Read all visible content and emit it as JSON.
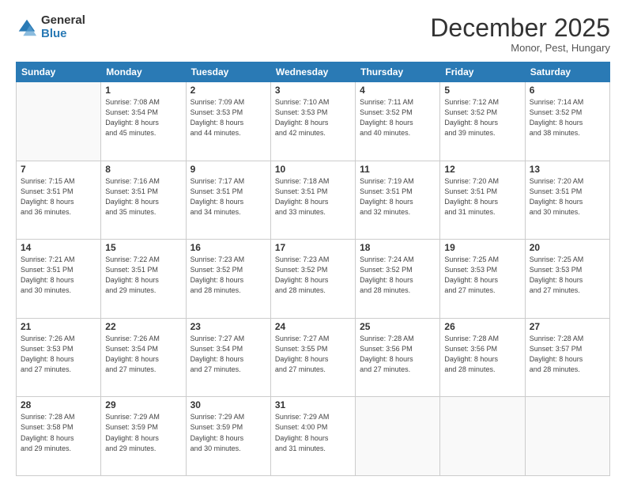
{
  "logo": {
    "general": "General",
    "blue": "Blue"
  },
  "header": {
    "month": "December 2025",
    "location": "Monor, Pest, Hungary"
  },
  "weekdays": [
    "Sunday",
    "Monday",
    "Tuesday",
    "Wednesday",
    "Thursday",
    "Friday",
    "Saturday"
  ],
  "weeks": [
    [
      {
        "day": "",
        "info": ""
      },
      {
        "day": "1",
        "info": "Sunrise: 7:08 AM\nSunset: 3:54 PM\nDaylight: 8 hours\nand 45 minutes."
      },
      {
        "day": "2",
        "info": "Sunrise: 7:09 AM\nSunset: 3:53 PM\nDaylight: 8 hours\nand 44 minutes."
      },
      {
        "day": "3",
        "info": "Sunrise: 7:10 AM\nSunset: 3:53 PM\nDaylight: 8 hours\nand 42 minutes."
      },
      {
        "day": "4",
        "info": "Sunrise: 7:11 AM\nSunset: 3:52 PM\nDaylight: 8 hours\nand 40 minutes."
      },
      {
        "day": "5",
        "info": "Sunrise: 7:12 AM\nSunset: 3:52 PM\nDaylight: 8 hours\nand 39 minutes."
      },
      {
        "day": "6",
        "info": "Sunrise: 7:14 AM\nSunset: 3:52 PM\nDaylight: 8 hours\nand 38 minutes."
      }
    ],
    [
      {
        "day": "7",
        "info": "Sunrise: 7:15 AM\nSunset: 3:51 PM\nDaylight: 8 hours\nand 36 minutes."
      },
      {
        "day": "8",
        "info": "Sunrise: 7:16 AM\nSunset: 3:51 PM\nDaylight: 8 hours\nand 35 minutes."
      },
      {
        "day": "9",
        "info": "Sunrise: 7:17 AM\nSunset: 3:51 PM\nDaylight: 8 hours\nand 34 minutes."
      },
      {
        "day": "10",
        "info": "Sunrise: 7:18 AM\nSunset: 3:51 PM\nDaylight: 8 hours\nand 33 minutes."
      },
      {
        "day": "11",
        "info": "Sunrise: 7:19 AM\nSunset: 3:51 PM\nDaylight: 8 hours\nand 32 minutes."
      },
      {
        "day": "12",
        "info": "Sunrise: 7:20 AM\nSunset: 3:51 PM\nDaylight: 8 hours\nand 31 minutes."
      },
      {
        "day": "13",
        "info": "Sunrise: 7:20 AM\nSunset: 3:51 PM\nDaylight: 8 hours\nand 30 minutes."
      }
    ],
    [
      {
        "day": "14",
        "info": "Sunrise: 7:21 AM\nSunset: 3:51 PM\nDaylight: 8 hours\nand 30 minutes."
      },
      {
        "day": "15",
        "info": "Sunrise: 7:22 AM\nSunset: 3:51 PM\nDaylight: 8 hours\nand 29 minutes."
      },
      {
        "day": "16",
        "info": "Sunrise: 7:23 AM\nSunset: 3:52 PM\nDaylight: 8 hours\nand 28 minutes."
      },
      {
        "day": "17",
        "info": "Sunrise: 7:23 AM\nSunset: 3:52 PM\nDaylight: 8 hours\nand 28 minutes."
      },
      {
        "day": "18",
        "info": "Sunrise: 7:24 AM\nSunset: 3:52 PM\nDaylight: 8 hours\nand 28 minutes."
      },
      {
        "day": "19",
        "info": "Sunrise: 7:25 AM\nSunset: 3:53 PM\nDaylight: 8 hours\nand 27 minutes."
      },
      {
        "day": "20",
        "info": "Sunrise: 7:25 AM\nSunset: 3:53 PM\nDaylight: 8 hours\nand 27 minutes."
      }
    ],
    [
      {
        "day": "21",
        "info": "Sunrise: 7:26 AM\nSunset: 3:53 PM\nDaylight: 8 hours\nand 27 minutes."
      },
      {
        "day": "22",
        "info": "Sunrise: 7:26 AM\nSunset: 3:54 PM\nDaylight: 8 hours\nand 27 minutes."
      },
      {
        "day": "23",
        "info": "Sunrise: 7:27 AM\nSunset: 3:54 PM\nDaylight: 8 hours\nand 27 minutes."
      },
      {
        "day": "24",
        "info": "Sunrise: 7:27 AM\nSunset: 3:55 PM\nDaylight: 8 hours\nand 27 minutes."
      },
      {
        "day": "25",
        "info": "Sunrise: 7:28 AM\nSunset: 3:56 PM\nDaylight: 8 hours\nand 27 minutes."
      },
      {
        "day": "26",
        "info": "Sunrise: 7:28 AM\nSunset: 3:56 PM\nDaylight: 8 hours\nand 28 minutes."
      },
      {
        "day": "27",
        "info": "Sunrise: 7:28 AM\nSunset: 3:57 PM\nDaylight: 8 hours\nand 28 minutes."
      }
    ],
    [
      {
        "day": "28",
        "info": "Sunrise: 7:28 AM\nSunset: 3:58 PM\nDaylight: 8 hours\nand 29 minutes."
      },
      {
        "day": "29",
        "info": "Sunrise: 7:29 AM\nSunset: 3:59 PM\nDaylight: 8 hours\nand 29 minutes."
      },
      {
        "day": "30",
        "info": "Sunrise: 7:29 AM\nSunset: 3:59 PM\nDaylight: 8 hours\nand 30 minutes."
      },
      {
        "day": "31",
        "info": "Sunrise: 7:29 AM\nSunset: 4:00 PM\nDaylight: 8 hours\nand 31 minutes."
      },
      {
        "day": "",
        "info": ""
      },
      {
        "day": "",
        "info": ""
      },
      {
        "day": "",
        "info": ""
      }
    ]
  ]
}
